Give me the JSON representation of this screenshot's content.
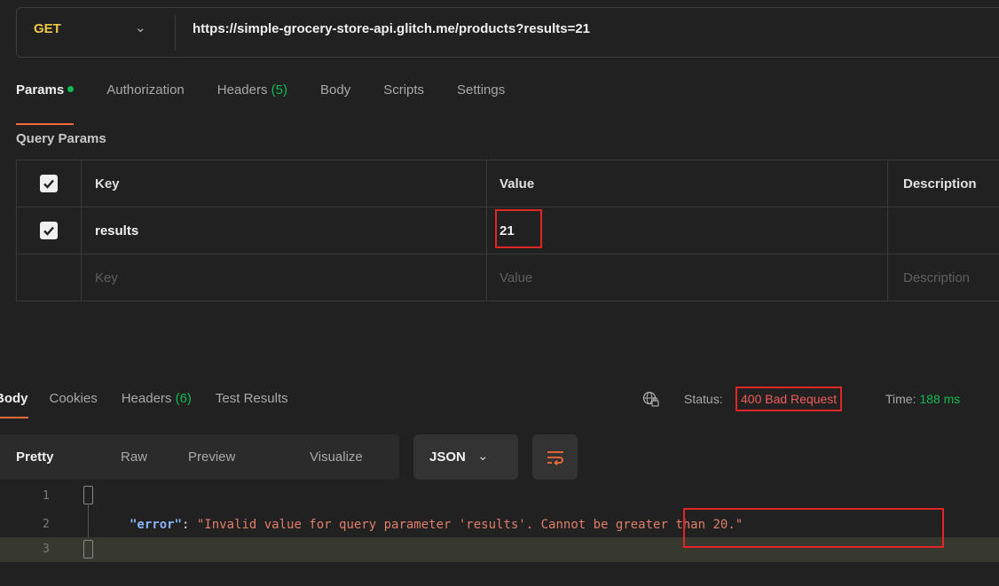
{
  "request": {
    "method": "GET",
    "url": "https://simple-grocery-store-api.glitch.me/products?results=21"
  },
  "request_tabs": [
    {
      "label": "Params",
      "active": true,
      "suffix": ""
    },
    {
      "label": "Authorization",
      "active": false,
      "suffix": ""
    },
    {
      "label": "Headers ",
      "active": false,
      "suffix": "(5)"
    },
    {
      "label": "Body",
      "active": false,
      "suffix": ""
    },
    {
      "label": "Scripts",
      "active": false,
      "suffix": ""
    },
    {
      "label": "Settings",
      "active": false,
      "suffix": ""
    }
  ],
  "query_params": {
    "title": "Query Params",
    "columns": [
      "Key",
      "Value",
      "Description"
    ],
    "rows": [
      {
        "checked": true,
        "key": "results",
        "value": "21",
        "description": ""
      }
    ],
    "placeholder": {
      "key": "Key",
      "value": "Value",
      "description": "Description"
    }
  },
  "response_tabs": [
    {
      "label": "Body",
      "active": true,
      "suffix": ""
    },
    {
      "label": "Cookies",
      "active": false,
      "suffix": ""
    },
    {
      "label": "Headers ",
      "active": false,
      "suffix": "(6)"
    },
    {
      "label": "Test Results",
      "active": false,
      "suffix": ""
    }
  ],
  "response_status": {
    "status_label": "Status:",
    "status_value": "400 Bad Request",
    "time_label": "Time:",
    "time_value": "188 ms"
  },
  "view_modes": [
    "Pretty",
    "Raw",
    "Preview",
    "Visualize"
  ],
  "active_view": "Pretty",
  "format": "JSON",
  "response_body": {
    "line_numbers": [
      "1",
      "2",
      "3"
    ],
    "key": "\"error\"",
    "colon": ": ",
    "value_part1": "\"Invalid value for query parameter 'results'. ",
    "value_part2": "Cannot be greater than 20",
    "value_end": ".\""
  },
  "colors": {
    "accent": "#f26b3a",
    "method": "#f2c744",
    "success_green": "#0cbb52",
    "error_red": "#f25b5b",
    "highlight_box": "#e1262a"
  }
}
